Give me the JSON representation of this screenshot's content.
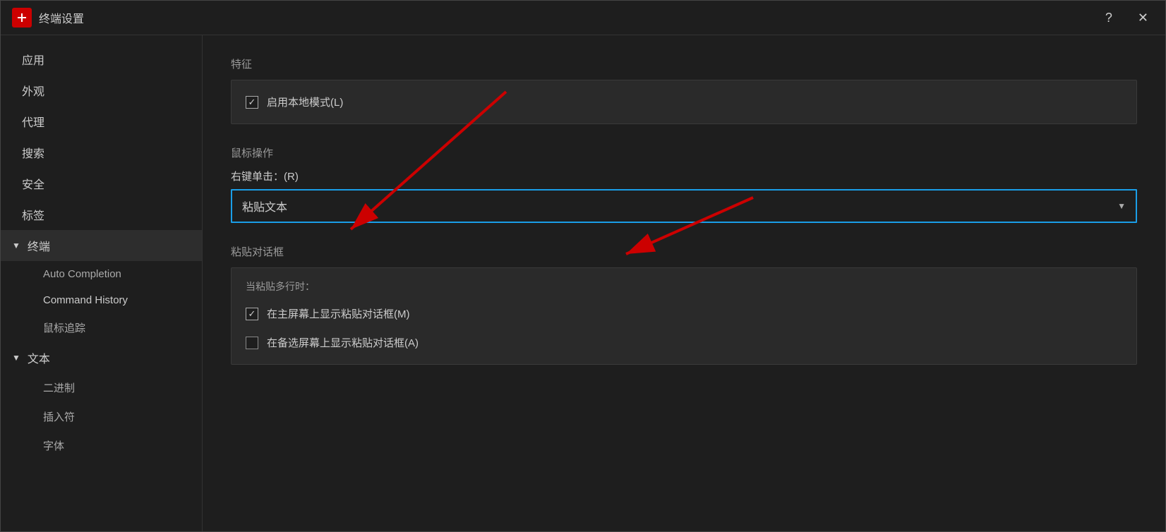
{
  "window": {
    "title": "终端设置",
    "help_btn": "?",
    "close_btn": "✕"
  },
  "sidebar": {
    "items": [
      {
        "label": "应用",
        "type": "item",
        "level": "top"
      },
      {
        "label": "外观",
        "type": "item",
        "level": "top"
      },
      {
        "label": "代理",
        "type": "item",
        "level": "top"
      },
      {
        "label": "搜索",
        "type": "item",
        "level": "top"
      },
      {
        "label": "安全",
        "type": "item",
        "level": "top"
      },
      {
        "label": "标签",
        "type": "item",
        "level": "top"
      },
      {
        "label": "终端",
        "type": "group",
        "expanded": true,
        "active": true
      },
      {
        "label": "Auto Completion",
        "type": "subitem"
      },
      {
        "label": "Command History",
        "type": "subitem"
      },
      {
        "label": "鼠标追踪",
        "type": "subitem"
      },
      {
        "label": "文本",
        "type": "group",
        "expanded": true
      },
      {
        "label": "二进制",
        "type": "subitem"
      },
      {
        "label": "插入符",
        "type": "subitem"
      },
      {
        "label": "字体",
        "type": "subitem"
      }
    ]
  },
  "content": {
    "features_section": {
      "title": "特征",
      "local_mode_label": "启用本地模式(L)",
      "local_mode_checked": true
    },
    "mouse_section": {
      "title": "鼠标操作",
      "right_click_label": "右键单击：(R)",
      "right_click_value": "粘贴文本"
    },
    "paste_section": {
      "title": "粘贴对话框",
      "sub_label": "当粘贴多行时：",
      "option1_label": "在主屏幕上显示粘贴对话框(M)",
      "option1_checked": true,
      "option2_label": "在备选屏幕上显示粘贴对话框(A)",
      "option2_checked": false
    }
  }
}
